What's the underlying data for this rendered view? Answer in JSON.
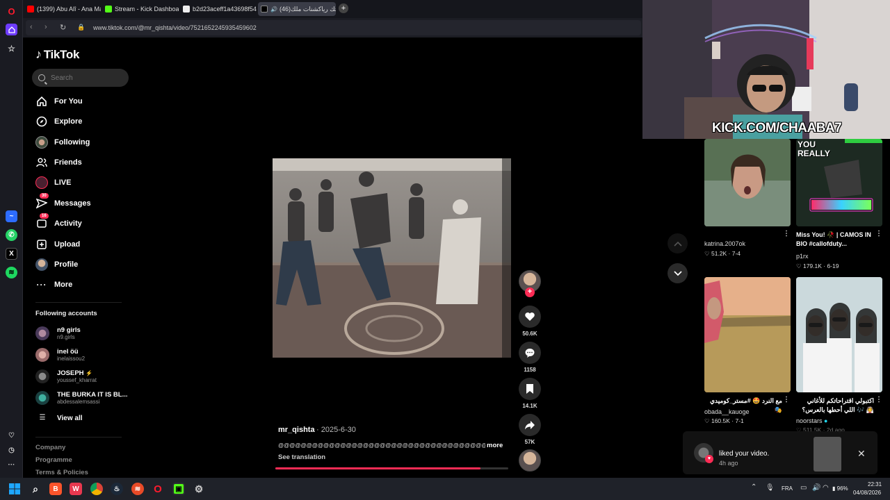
{
  "browser": {
    "tabs": [
      {
        "label": "(1399) Abu Alî - Ana Maro"
      },
      {
        "label": "Stream - Kick Dashboard"
      },
      {
        "label": "b2d23aceff1a43698f54e2d"
      },
      {
        "label": "ضحك رياكشنات ملك(46)"
      }
    ],
    "new_tab": "+",
    "url": "www.tiktok.com/@mr_qishta/video/7521652245935459602"
  },
  "sidebar": {
    "logo": "TikTok",
    "search_placeholder": "Search",
    "items": [
      {
        "label": "For You",
        "icon": "home-icon"
      },
      {
        "label": "Explore",
        "icon": "compass-icon"
      },
      {
        "label": "Following",
        "icon": "following-avatar-icon"
      },
      {
        "label": "Friends",
        "icon": "friends-icon"
      },
      {
        "label": "LIVE",
        "icon": "live-icon"
      },
      {
        "label": "Messages",
        "icon": "messages-icon",
        "badge": "30"
      },
      {
        "label": "Activity",
        "icon": "activity-icon",
        "badge": "16"
      },
      {
        "label": "Upload",
        "icon": "upload-icon"
      },
      {
        "label": "Profile",
        "icon": "profile-icon"
      },
      {
        "label": "More",
        "icon": "more-icon"
      }
    ],
    "following_title": "Following accounts",
    "accounts": [
      {
        "name": "n9 girls",
        "handle": "n9.girls"
      },
      {
        "name": "inel öü",
        "handle": "inelaissou2"
      },
      {
        "name": "JOSEPH",
        "handle": "youssef_kharrat"
      },
      {
        "name": "THE BURKA IT IS BL...",
        "handle": "abdessalemsassi"
      }
    ],
    "view_all": "View all",
    "footer": [
      "Company",
      "Programme",
      "Terms & Policies"
    ]
  },
  "video": {
    "username": "mr_qishta",
    "date": "· 2025-6-30",
    "description": "@@@@@@@@@@@@@@@@@@@@@@@@@@@@@@@@@@@@@@@@@@@@@@@@@@@@@@@@ئ",
    "more": "more",
    "see_translation": "See translation",
    "progress": 0.88
  },
  "actions": {
    "likes": "50.6K",
    "comments": "1158",
    "saves": "14.1K",
    "shares": "57K"
  },
  "stream_overlay": "KICK.COM/CHAABA7",
  "recommendations": [
    {
      "title": "",
      "author": "katrina.2007ok",
      "stats": "♡ 51.2K · 7-4"
    },
    {
      "title": "Miss You! 🥀 | CAMOS IN BIO #callofduty...",
      "author": "p1rx",
      "stats": "♡ 179.1K · 6-19"
    },
    {
      "title": "مع النرد 🤩 #مستر_كوميدي 🎭",
      "author": "obada__kauoge",
      "stats": "♡ 160.5K · 7-1"
    },
    {
      "title": "اكتبولي اقتراحاتكم للأغاني اللي أحطها بالعرس؟ 🎶 👰",
      "author": "noorstars",
      "stats": "♡ 511.5K · 2d ago"
    }
  ],
  "card_text": {
    "you_really": "YOU REALLY"
  },
  "toast": {
    "text": "liked your video.",
    "time": "4h ago"
  },
  "taskbar": {
    "lang": "FRA",
    "battery": "96%",
    "time": "22:31",
    "date": "04/08/2026"
  }
}
